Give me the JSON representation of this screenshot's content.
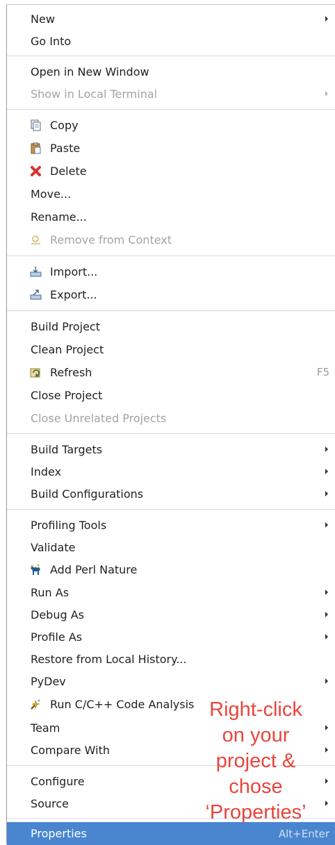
{
  "menu": {
    "items": [
      {
        "label": "New",
        "submenu": true
      },
      {
        "label": "Go Into"
      },
      {
        "label": "Open in New Window"
      },
      {
        "label": "Show in Local Terminal",
        "disabled": true,
        "submenu": true
      },
      {
        "label": "Copy",
        "icon": "copy-icon"
      },
      {
        "label": "Paste",
        "icon": "paste-icon"
      },
      {
        "label": "Delete",
        "icon": "delete-icon"
      },
      {
        "label": "Move..."
      },
      {
        "label": "Rename..."
      },
      {
        "label": "Remove from Context",
        "icon": "remove-context-icon",
        "disabled": true
      },
      {
        "label": "Import...",
        "icon": "import-icon"
      },
      {
        "label": "Export...",
        "icon": "export-icon"
      },
      {
        "label": "Build Project"
      },
      {
        "label": "Clean Project"
      },
      {
        "label": "Refresh",
        "icon": "refresh-icon",
        "accelerator": "F5"
      },
      {
        "label": "Close Project"
      },
      {
        "label": "Close Unrelated Projects",
        "disabled": true
      },
      {
        "label": "Build Targets",
        "submenu": true
      },
      {
        "label": "Index",
        "submenu": true
      },
      {
        "label": "Build Configurations",
        "submenu": true
      },
      {
        "label": "Profiling Tools",
        "submenu": true
      },
      {
        "label": "Validate"
      },
      {
        "label": "Add Perl Nature",
        "icon": "perl-camel-icon"
      },
      {
        "label": "Run As",
        "submenu": true
      },
      {
        "label": "Debug As",
        "submenu": true
      },
      {
        "label": "Profile As",
        "submenu": true
      },
      {
        "label": "Restore from Local History..."
      },
      {
        "label": "PyDev",
        "submenu": true
      },
      {
        "label": "Run C/C++ Code Analysis",
        "icon": "code-analysis-icon"
      },
      {
        "label": "Team",
        "submenu": true
      },
      {
        "label": "Compare With",
        "submenu": true
      },
      {
        "label": "Configure",
        "submenu": true
      },
      {
        "label": "Source",
        "submenu": true
      },
      {
        "label": "Properties",
        "accelerator": "Alt+Enter",
        "highlighted": true
      }
    ]
  },
  "annotation": {
    "line1": "Right-click",
    "line2": "on your",
    "line3": "project &",
    "line4": "chose",
    "line5": "‘Properties’",
    "color": "#e8453c"
  },
  "colors": {
    "highlight": "#4a86cf",
    "disabled_text": "#a3a3a3"
  }
}
